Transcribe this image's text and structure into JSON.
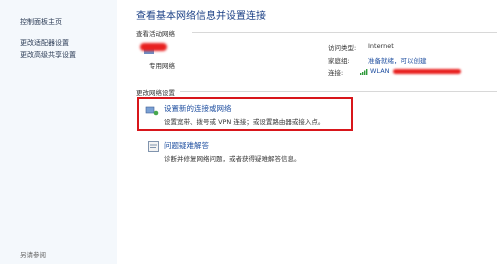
{
  "sidebar": {
    "items": [
      {
        "label": "控制面板主页"
      },
      {
        "label": "更改适配器设置"
      },
      {
        "label": "更改高级共享设置"
      }
    ],
    "footer": "另请参阅"
  },
  "main": {
    "title": "查看基本网络信息并设置连接",
    "active_networks_label": "查看活动网络",
    "network_type": "专用网络",
    "access_type_label": "访问类型:",
    "access_type_value": "Internet",
    "homegroup_label": "家庭组:",
    "homegroup_value": "准备就绪，可以创建",
    "connection_label": "连接:",
    "connection_value": "WLAN",
    "change_settings_label": "更改网络设置",
    "tasks": [
      {
        "title": "设置新的连接或网络",
        "description": "设置宽带、拨号或 VPN 连接；或设置路由器或接入点。",
        "icon": "network-connection-icon"
      },
      {
        "title": "问题疑难解答",
        "description": "诊断并修复网络问题，或者获得疑难解答信息。",
        "icon": "troubleshoot-icon"
      }
    ]
  },
  "colors": {
    "link": "#1f4fa0",
    "title": "#1a3f85",
    "highlight": "#d8161b",
    "redaction": "#e8201f"
  }
}
